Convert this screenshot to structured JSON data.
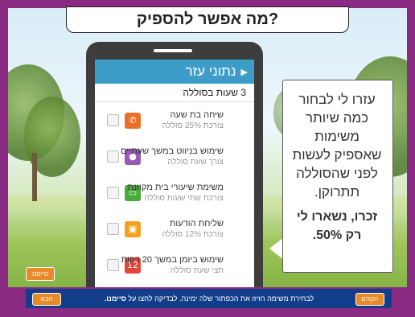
{
  "title": "מה אפשר להספיק?",
  "phone": {
    "header": "נתוני עזר",
    "battery_label": "3 שעות בסוללה",
    "tasks": [
      {
        "name": "שיחה בת שעה",
        "cost": "צורכת 25% סוללה",
        "icon": "phone-icon",
        "color": "#e8702a"
      },
      {
        "name": "שימוש בניווט במשך שעתיים",
        "cost": "צורך שעת סוללה",
        "icon": "location-pin-icon",
        "color": "#9b59b6"
      },
      {
        "name": "משימת שיעורי בית מקוונת",
        "cost": "צורכת שתי שעות סוללה",
        "icon": "monitor-icon",
        "color": "#4aaa3a"
      },
      {
        "name": "שליחת הודעות",
        "cost": "צורכת 12% סוללה",
        "icon": "message-icon",
        "color": "#f2a01f"
      },
      {
        "name": "שימוש ביומן במשך 20 דקות",
        "cost": "חצי שעת סוללה",
        "icon": "calendar-icon",
        "color": "#e0483a",
        "icon_text": "12"
      }
    ]
  },
  "bubble": {
    "main": "עזרו לי לבחור כמה שיותר משימות שאספיק לעשות לפני שהסוללה תתרוקן.",
    "bold": "זכרו, נשארו לי רק 50%."
  },
  "buttons": {
    "simani": "סיימנו",
    "next": "הבא",
    "prev": "הקודם"
  },
  "instructions": {
    "text": "לבחירת משימה הזיזו את הכפתור שלה ימינה. לבדיקה לחצו על",
    "bold": "סיימנו."
  }
}
